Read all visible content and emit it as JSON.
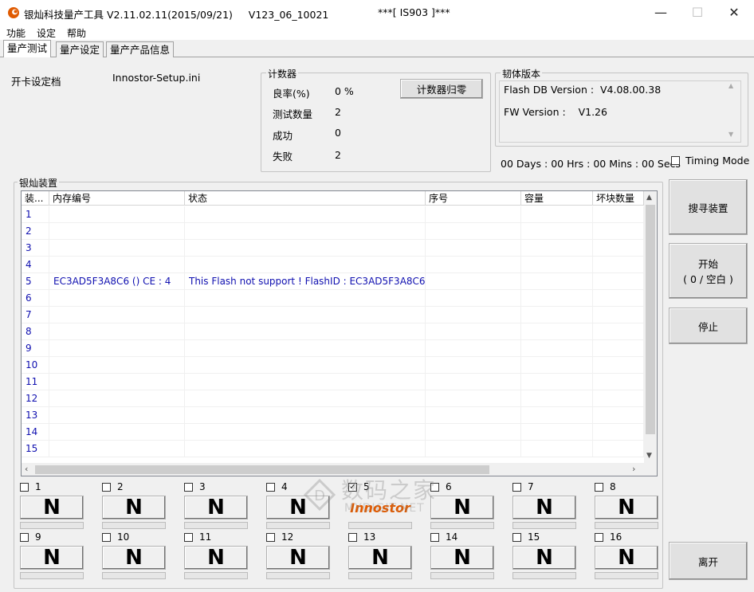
{
  "window": {
    "title": "银灿科技量产工具 V2.11.02.11(2015/09/21)     V123_06_10021",
    "center_title": "***[ IS903 ]***",
    "controls": {
      "minimize": "—",
      "maximize": "☐",
      "close": "✕"
    },
    "accent_color": "#e05a00"
  },
  "menu": [
    "功能",
    "设定",
    "帮助"
  ],
  "tabs": [
    "量产测试",
    "量产设定",
    "量产产品信息"
  ],
  "boot": {
    "label": "开卡设定档",
    "value": "Innostor-Setup.ini"
  },
  "counter": {
    "title": "计数器",
    "rows": [
      {
        "label": "良率(%)",
        "value": "0 %"
      },
      {
        "label": "测试数量",
        "value": "2"
      },
      {
        "label": "成功",
        "value": "0"
      },
      {
        "label": "失败",
        "value": "2"
      }
    ],
    "reset_button": "计数器归零"
  },
  "firmware": {
    "title": "韧体版本",
    "flash_db": "Flash DB Version :  V4.08.00.38",
    "fw": "FW Version :    V1.26"
  },
  "timer": "00 Days : 00 Hrs : 00 Mins : 00 Secs",
  "timing_mode": "Timing Mode",
  "devices": {
    "title": "银灿装置",
    "columns": [
      "装...",
      "内存编号",
      "状态",
      "序号",
      "容量",
      "坏块数量"
    ],
    "rows": [
      {
        "n": "1",
        "mem": "",
        "status": ""
      },
      {
        "n": "2",
        "mem": "",
        "status": ""
      },
      {
        "n": "3",
        "mem": "",
        "status": ""
      },
      {
        "n": "4",
        "mem": "",
        "status": ""
      },
      {
        "n": "5",
        "mem": "EC3AD5F3A8C6 () CE : 4",
        "status": "This Flash not support ! FlashID : EC3AD5F3A8C6"
      },
      {
        "n": "6",
        "mem": "",
        "status": ""
      },
      {
        "n": "7",
        "mem": "",
        "status": ""
      },
      {
        "n": "8",
        "mem": "",
        "status": ""
      },
      {
        "n": "9",
        "mem": "",
        "status": ""
      },
      {
        "n": "10",
        "mem": "",
        "status": ""
      },
      {
        "n": "11",
        "mem": "",
        "status": ""
      },
      {
        "n": "12",
        "mem": "",
        "status": ""
      },
      {
        "n": "13",
        "mem": "",
        "status": ""
      },
      {
        "n": "14",
        "mem": "",
        "status": ""
      },
      {
        "n": "15",
        "mem": "",
        "status": ""
      }
    ]
  },
  "buttons": {
    "search": "搜寻装置",
    "start_line1": "开始",
    "start_line2": "( 0 / 空白  )",
    "stop": "停止",
    "exit": "离开"
  },
  "slots": [
    {
      "num": "1",
      "checked": false,
      "state": "N"
    },
    {
      "num": "2",
      "checked": false,
      "state": "N"
    },
    {
      "num": "3",
      "checked": false,
      "state": "N"
    },
    {
      "num": "4",
      "checked": false,
      "state": "N"
    },
    {
      "num": "5",
      "checked": true,
      "state": "Innostor"
    },
    {
      "num": "6",
      "checked": false,
      "state": "N"
    },
    {
      "num": "7",
      "checked": false,
      "state": "N"
    },
    {
      "num": "8",
      "checked": false,
      "state": "N"
    },
    {
      "num": "9",
      "checked": false,
      "state": "N"
    },
    {
      "num": "10",
      "checked": false,
      "state": "N"
    },
    {
      "num": "11",
      "checked": false,
      "state": "N"
    },
    {
      "num": "12",
      "checked": false,
      "state": "N"
    },
    {
      "num": "13",
      "checked": false,
      "state": "N"
    },
    {
      "num": "14",
      "checked": false,
      "state": "N"
    },
    {
      "num": "15",
      "checked": false,
      "state": "N"
    },
    {
      "num": "16",
      "checked": false,
      "state": "N"
    }
  ],
  "watermark": {
    "line1": "数码之家",
    "line2": "MYDIGIT.NET"
  }
}
